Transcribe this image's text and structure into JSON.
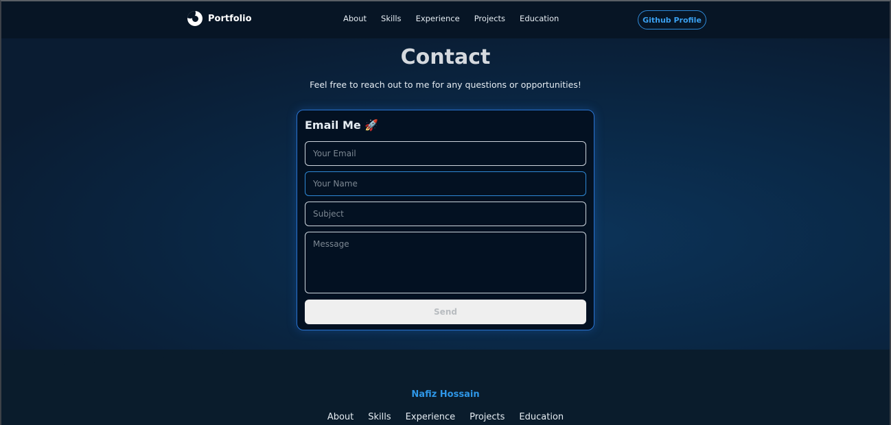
{
  "navbar": {
    "brand": "Portfolio",
    "links": [
      "About",
      "Skills",
      "Experience",
      "Projects",
      "Education"
    ],
    "github_label": "Github Profile"
  },
  "contact": {
    "title": "Contact",
    "subtitle": "Feel free to reach out to me for any questions or opportunities!",
    "form": {
      "heading": "Email Me 🚀",
      "email_placeholder": "Your Email",
      "name_placeholder": "Your Name",
      "subject_placeholder": "Subject",
      "message_placeholder": "Message",
      "send_label": "Send"
    }
  },
  "footer": {
    "name": "Nafiz Hossain",
    "links": [
      "About",
      "Skills",
      "Experience",
      "Projects",
      "Education"
    ]
  },
  "colors": {
    "accent": "#2e97e8",
    "background": "#0a1a2b",
    "card": "#031122"
  }
}
